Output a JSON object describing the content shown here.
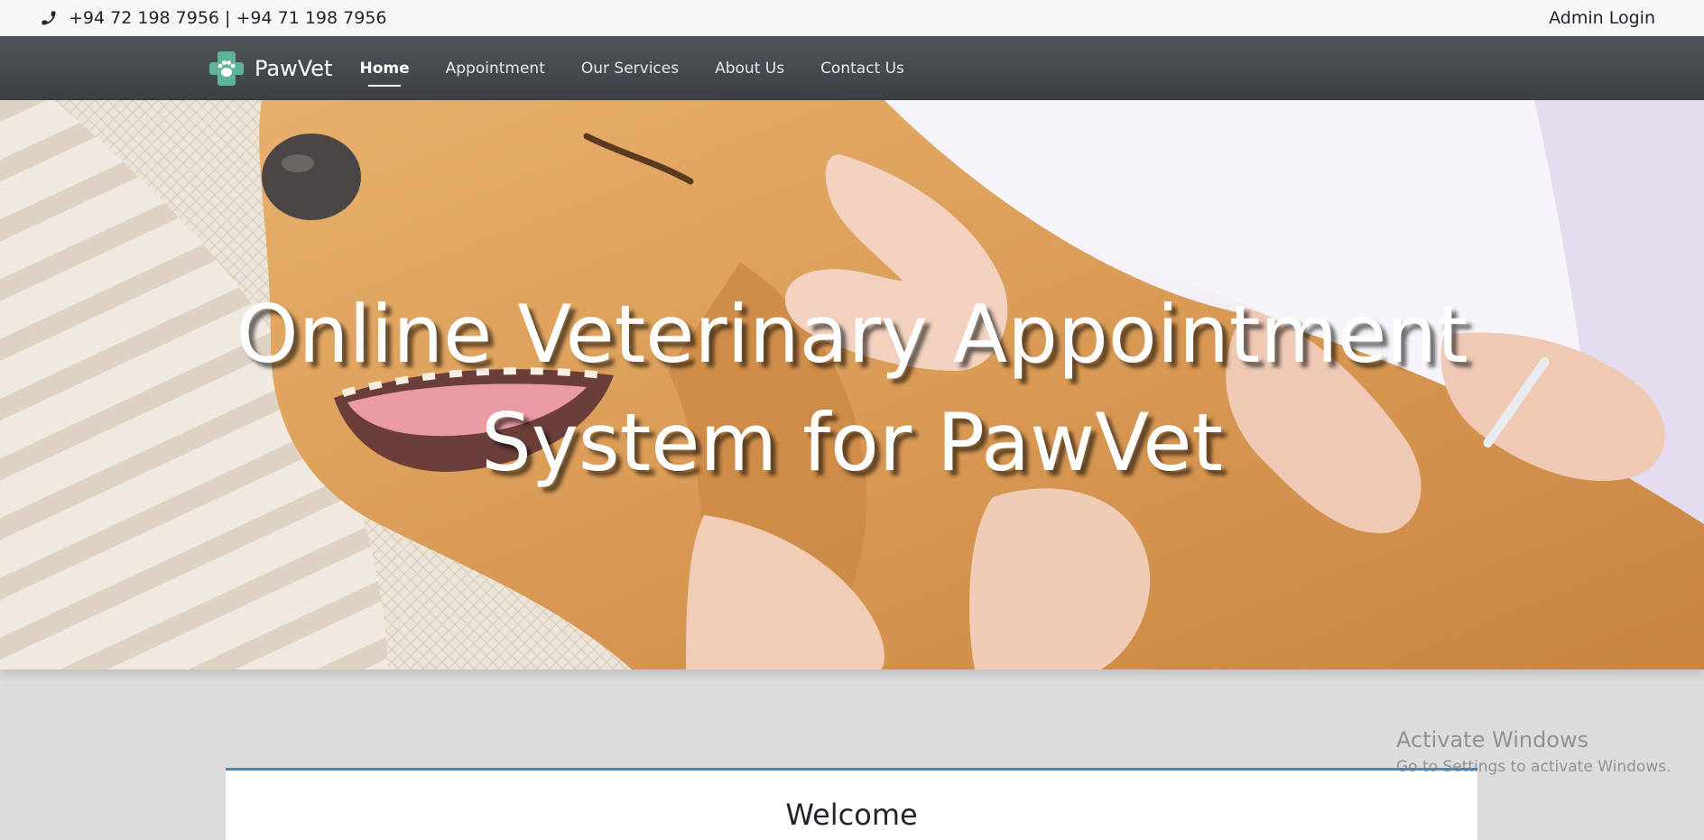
{
  "topbar": {
    "phone_icon": "phone-icon",
    "phones": "+94 72 198 7956 | +94 71 198 7956",
    "admin_login": "Admin Login"
  },
  "navbar": {
    "brand": "PawVet",
    "brand_icon": "paw-cross-logo",
    "links": [
      "Home",
      "Appointment",
      "Our Services",
      "About Us",
      "Contact Us"
    ],
    "active": "Home"
  },
  "hero": {
    "title_line1": "Online Veterinary Appointment",
    "title_line2": "System for PawVet"
  },
  "welcome": {
    "heading": "Welcome"
  },
  "watermark": {
    "line1": "Activate Windows",
    "line2": "Go to Settings to activate Windows."
  },
  "colors": {
    "navbar": "#43484d",
    "topbar": "#f6f7f9",
    "brand_green": "#5fb39a",
    "welcome_border": "#3b8cc6"
  }
}
